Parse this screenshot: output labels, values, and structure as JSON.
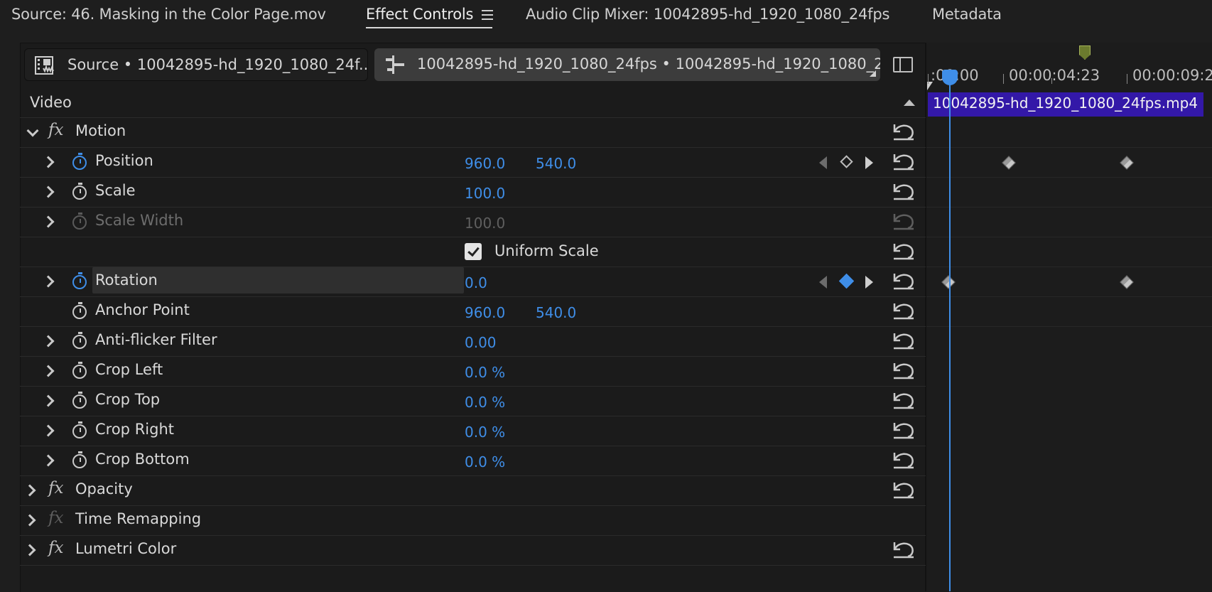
{
  "tabs": {
    "source": "Source: 46. Masking in the Color Page.mov",
    "effect_controls": "Effect Controls",
    "audio_mixer": "Audio Clip Mixer: 10042895-hd_1920_1080_24fps",
    "metadata": "Metadata"
  },
  "clip_selectors": {
    "source": "Source • 10042895-hd_1920_1080_24f...",
    "sequence": "10042895-hd_1920_1080_24fps • 10042895-hd_1920_1080_2..."
  },
  "section": "Video",
  "timeline": {
    "ruler": [
      ":00:00",
      "00:00:04:23",
      "00:00:09:2"
    ],
    "clip_name": "10042895-hd_1920_1080_24fps.mp4"
  },
  "effects": {
    "motion": "Motion",
    "opacity": "Opacity",
    "time_remapping": "Time Remapping",
    "lumetri": "Lumetri Color"
  },
  "params": {
    "position": {
      "label": "Position",
      "x": "960.0",
      "y": "540.0"
    },
    "scale": {
      "label": "Scale",
      "value": "100.0"
    },
    "scale_width": {
      "label": "Scale Width",
      "value": "100.0"
    },
    "uniform_scale": {
      "label": "Uniform Scale",
      "checked": true
    },
    "rotation": {
      "label": "Rotation",
      "value": "0.0"
    },
    "anchor_point": {
      "label": "Anchor Point",
      "x": "960.0",
      "y": "540.0"
    },
    "anti_flicker": {
      "label": "Anti-flicker Filter",
      "value": "0.00"
    },
    "crop_left": {
      "label": "Crop Left",
      "value": "0.0 %"
    },
    "crop_top": {
      "label": "Crop Top",
      "value": "0.0 %"
    },
    "crop_right": {
      "label": "Crop Right",
      "value": "0.0 %"
    },
    "crop_bottom": {
      "label": "Crop Bottom",
      "value": "0.0 %"
    }
  },
  "colors": {
    "accent": "#3f8ee8",
    "clip": "#3318a8",
    "background": "#1b1b1b"
  }
}
